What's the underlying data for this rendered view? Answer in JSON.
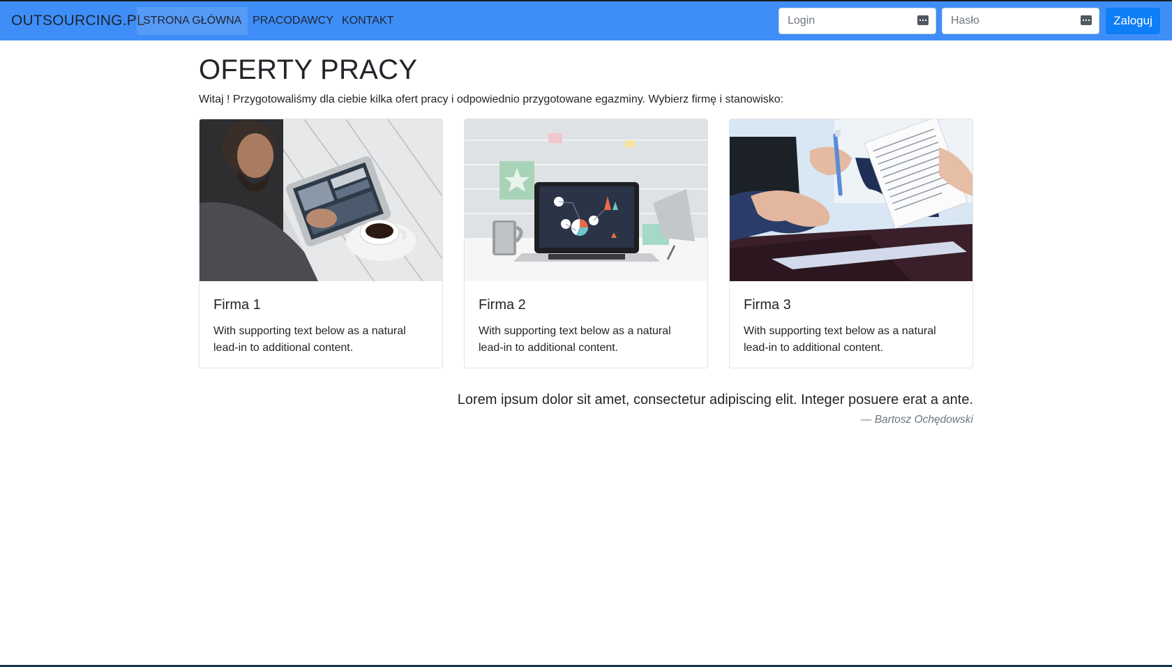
{
  "navbar": {
    "brand": "OUTSOURCING.PL",
    "items": [
      {
        "label": "STRONA GŁÓWNA",
        "active": true
      },
      {
        "label": "PRACODAWCY",
        "active": false
      },
      {
        "label": "KONTAKT",
        "active": false
      }
    ],
    "login": {
      "placeholder": "Login",
      "value": ""
    },
    "password": {
      "placeholder": "Hasło",
      "value": ""
    },
    "submit_label": "Zaloguj",
    "colors": {
      "bar": "#3f8ef8",
      "button": "#0d7ef5"
    }
  },
  "main": {
    "title": "OFERTY PRACY",
    "intro": "Witaj ! Przygotowaliśmy dla ciebie kilka ofert pracy i odpowiednio przygotowane egazminy. Wybierz firmę i stanowisko:",
    "cards": [
      {
        "title": "Firma 1",
        "text": "With supporting text below as a natural lead-in to additional content.",
        "image": "photo-man-with-tablet-and-coffee"
      },
      {
        "title": "Firma 2",
        "text": "With supporting text below as a natural lead-in to additional content.",
        "image": "photo-laptop-with-charts-on-desk"
      },
      {
        "title": "Firma 3",
        "text": "With supporting text below as a natural lead-in to additional content.",
        "image": "photo-hands-signing-documents"
      }
    ],
    "quote": {
      "text": "Lorem ipsum dolor sit amet, consectetur adipiscing elit. Integer posuere erat a ante.",
      "author": "— Bartosz Ochędowski"
    }
  }
}
